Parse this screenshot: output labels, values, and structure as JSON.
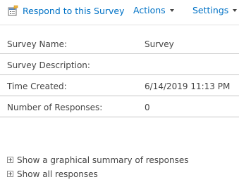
{
  "toolbar": {
    "respond_label": "Respond to this Survey",
    "actions_label": "Actions",
    "settings_label": "Settings",
    "respond_icon": "survey-respond-icon",
    "dropdown_icon": "caret-down-icon"
  },
  "properties": [
    {
      "label": "Survey Name:",
      "value": "Survey"
    },
    {
      "label": "Survey Description:",
      "value": ""
    },
    {
      "label": "Time Created:",
      "value": "6/14/2019 11:13 PM"
    },
    {
      "label": "Number of Responses:",
      "value": "0"
    }
  ],
  "links": {
    "graphical_summary": "Show a graphical summary of responses",
    "all_responses": "Show all responses",
    "expand_icon": "plus-box-icon"
  },
  "colors": {
    "link_blue": "#0072c6",
    "text": "#444444",
    "divider": "#c6c6c6"
  }
}
